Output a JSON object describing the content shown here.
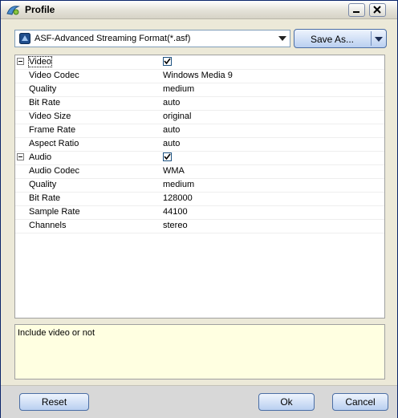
{
  "window": {
    "title": "Profile",
    "minimize_icon": "minimize-icon",
    "close_icon": "close-icon"
  },
  "format": {
    "selected": "ASF-Advanced Streaming Format(*.asf)"
  },
  "save_as": {
    "label": "Save As..."
  },
  "properties": {
    "video": {
      "label": "Video",
      "checked": true,
      "rows": [
        {
          "name": "Video Codec",
          "value": "Windows Media 9"
        },
        {
          "name": "Quality",
          "value": "medium"
        },
        {
          "name": "Bit Rate",
          "value": "auto"
        },
        {
          "name": "Video Size",
          "value": "original"
        },
        {
          "name": "Frame Rate",
          "value": "auto"
        },
        {
          "name": "Aspect Ratio",
          "value": "auto"
        }
      ]
    },
    "audio": {
      "label": "Audio",
      "checked": true,
      "rows": [
        {
          "name": "Audio Codec",
          "value": "WMA"
        },
        {
          "name": "Quality",
          "value": "medium"
        },
        {
          "name": "Bit Rate",
          "value": "128000"
        },
        {
          "name": "Sample Rate",
          "value": "44100"
        },
        {
          "name": "Channels",
          "value": "stereo"
        }
      ]
    }
  },
  "description": "Include video or not",
  "buttons": {
    "reset": "Reset",
    "ok": "Ok",
    "cancel": "Cancel"
  }
}
